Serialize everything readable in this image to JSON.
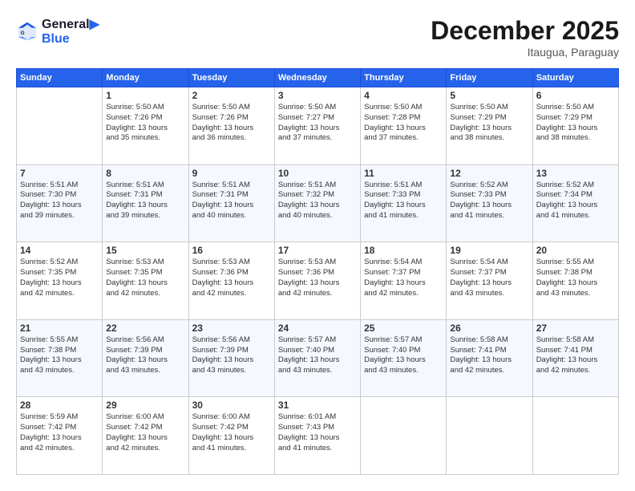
{
  "header": {
    "logo_line1": "General",
    "logo_line2": "Blue",
    "main_title": "December 2025",
    "subtitle": "Itaugua, Paraguay"
  },
  "days_of_week": [
    "Sunday",
    "Monday",
    "Tuesday",
    "Wednesday",
    "Thursday",
    "Friday",
    "Saturday"
  ],
  "weeks": [
    [
      {
        "day": "",
        "info": ""
      },
      {
        "day": "1",
        "info": "Sunrise: 5:50 AM\nSunset: 7:26 PM\nDaylight: 13 hours\nand 35 minutes."
      },
      {
        "day": "2",
        "info": "Sunrise: 5:50 AM\nSunset: 7:26 PM\nDaylight: 13 hours\nand 36 minutes."
      },
      {
        "day": "3",
        "info": "Sunrise: 5:50 AM\nSunset: 7:27 PM\nDaylight: 13 hours\nand 37 minutes."
      },
      {
        "day": "4",
        "info": "Sunrise: 5:50 AM\nSunset: 7:28 PM\nDaylight: 13 hours\nand 37 minutes."
      },
      {
        "day": "5",
        "info": "Sunrise: 5:50 AM\nSunset: 7:29 PM\nDaylight: 13 hours\nand 38 minutes."
      },
      {
        "day": "6",
        "info": "Sunrise: 5:50 AM\nSunset: 7:29 PM\nDaylight: 13 hours\nand 38 minutes."
      }
    ],
    [
      {
        "day": "7",
        "info": "Sunrise: 5:51 AM\nSunset: 7:30 PM\nDaylight: 13 hours\nand 39 minutes."
      },
      {
        "day": "8",
        "info": "Sunrise: 5:51 AM\nSunset: 7:31 PM\nDaylight: 13 hours\nand 39 minutes."
      },
      {
        "day": "9",
        "info": "Sunrise: 5:51 AM\nSunset: 7:31 PM\nDaylight: 13 hours\nand 40 minutes."
      },
      {
        "day": "10",
        "info": "Sunrise: 5:51 AM\nSunset: 7:32 PM\nDaylight: 13 hours\nand 40 minutes."
      },
      {
        "day": "11",
        "info": "Sunrise: 5:51 AM\nSunset: 7:33 PM\nDaylight: 13 hours\nand 41 minutes."
      },
      {
        "day": "12",
        "info": "Sunrise: 5:52 AM\nSunset: 7:33 PM\nDaylight: 13 hours\nand 41 minutes."
      },
      {
        "day": "13",
        "info": "Sunrise: 5:52 AM\nSunset: 7:34 PM\nDaylight: 13 hours\nand 41 minutes."
      }
    ],
    [
      {
        "day": "14",
        "info": "Sunrise: 5:52 AM\nSunset: 7:35 PM\nDaylight: 13 hours\nand 42 minutes."
      },
      {
        "day": "15",
        "info": "Sunrise: 5:53 AM\nSunset: 7:35 PM\nDaylight: 13 hours\nand 42 minutes."
      },
      {
        "day": "16",
        "info": "Sunrise: 5:53 AM\nSunset: 7:36 PM\nDaylight: 13 hours\nand 42 minutes."
      },
      {
        "day": "17",
        "info": "Sunrise: 5:53 AM\nSunset: 7:36 PM\nDaylight: 13 hours\nand 42 minutes."
      },
      {
        "day": "18",
        "info": "Sunrise: 5:54 AM\nSunset: 7:37 PM\nDaylight: 13 hours\nand 42 minutes."
      },
      {
        "day": "19",
        "info": "Sunrise: 5:54 AM\nSunset: 7:37 PM\nDaylight: 13 hours\nand 43 minutes."
      },
      {
        "day": "20",
        "info": "Sunrise: 5:55 AM\nSunset: 7:38 PM\nDaylight: 13 hours\nand 43 minutes."
      }
    ],
    [
      {
        "day": "21",
        "info": "Sunrise: 5:55 AM\nSunset: 7:38 PM\nDaylight: 13 hours\nand 43 minutes."
      },
      {
        "day": "22",
        "info": "Sunrise: 5:56 AM\nSunset: 7:39 PM\nDaylight: 13 hours\nand 43 minutes."
      },
      {
        "day": "23",
        "info": "Sunrise: 5:56 AM\nSunset: 7:39 PM\nDaylight: 13 hours\nand 43 minutes."
      },
      {
        "day": "24",
        "info": "Sunrise: 5:57 AM\nSunset: 7:40 PM\nDaylight: 13 hours\nand 43 minutes."
      },
      {
        "day": "25",
        "info": "Sunrise: 5:57 AM\nSunset: 7:40 PM\nDaylight: 13 hours\nand 43 minutes."
      },
      {
        "day": "26",
        "info": "Sunrise: 5:58 AM\nSunset: 7:41 PM\nDaylight: 13 hours\nand 42 minutes."
      },
      {
        "day": "27",
        "info": "Sunrise: 5:58 AM\nSunset: 7:41 PM\nDaylight: 13 hours\nand 42 minutes."
      }
    ],
    [
      {
        "day": "28",
        "info": "Sunrise: 5:59 AM\nSunset: 7:42 PM\nDaylight: 13 hours\nand 42 minutes."
      },
      {
        "day": "29",
        "info": "Sunrise: 6:00 AM\nSunset: 7:42 PM\nDaylight: 13 hours\nand 42 minutes."
      },
      {
        "day": "30",
        "info": "Sunrise: 6:00 AM\nSunset: 7:42 PM\nDaylight: 13 hours\nand 41 minutes."
      },
      {
        "day": "31",
        "info": "Sunrise: 6:01 AM\nSunset: 7:43 PM\nDaylight: 13 hours\nand 41 minutes."
      },
      {
        "day": "",
        "info": ""
      },
      {
        "day": "",
        "info": ""
      },
      {
        "day": "",
        "info": ""
      }
    ]
  ]
}
